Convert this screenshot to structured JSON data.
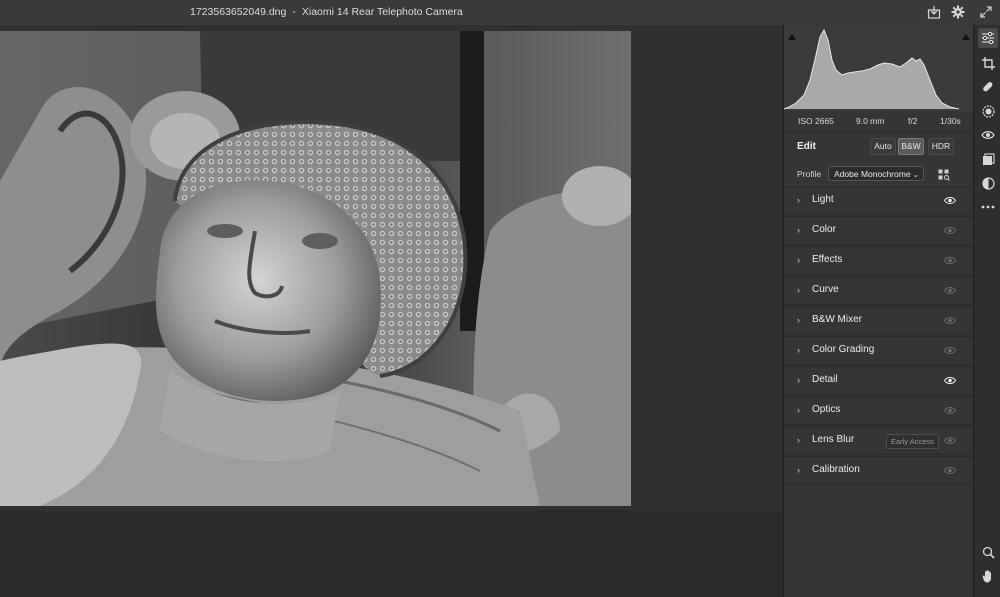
{
  "window": {
    "filename": "1723563652049.dng",
    "separator": "-",
    "camera": "Xiaomi 14 Rear Telephoto Camera"
  },
  "histogram": {
    "iso": "ISO 2665",
    "focal_length": "9.0 mm",
    "aperture": "f/2",
    "shutter": "1/30s"
  },
  "edit": {
    "label": "Edit",
    "modes": [
      "Auto",
      "B&W",
      "HDR"
    ],
    "active_mode": "B&W",
    "profile_label": "Profile",
    "profile_value": "Adobe Monochrome"
  },
  "sections": [
    {
      "label": "Light",
      "visible_active": true
    },
    {
      "label": "Color",
      "visible_active": false
    },
    {
      "label": "Effects",
      "visible_active": false
    },
    {
      "label": "Curve",
      "visible_active": false
    },
    {
      "label": "B&W Mixer",
      "visible_active": false
    },
    {
      "label": "Color Grading",
      "visible_active": false
    },
    {
      "label": "Detail",
      "visible_active": true
    },
    {
      "label": "Optics",
      "visible_active": false
    },
    {
      "label": "Lens Blur",
      "visible_active": false,
      "badge": "Early Access"
    },
    {
      "label": "Calibration",
      "visible_active": false
    }
  ],
  "colors": {
    "panel_bg": "#353535",
    "canvas_bg": "#303030",
    "active_mode_bg": "#5a5a5a"
  },
  "tools": [
    "edit-sliders-icon",
    "crop-icon",
    "healing-brush-icon",
    "masking-icon",
    "red-eye-icon",
    "presets-icon",
    "snapshots-icon",
    "more-icon",
    "zoom-icon",
    "hand-icon"
  ]
}
